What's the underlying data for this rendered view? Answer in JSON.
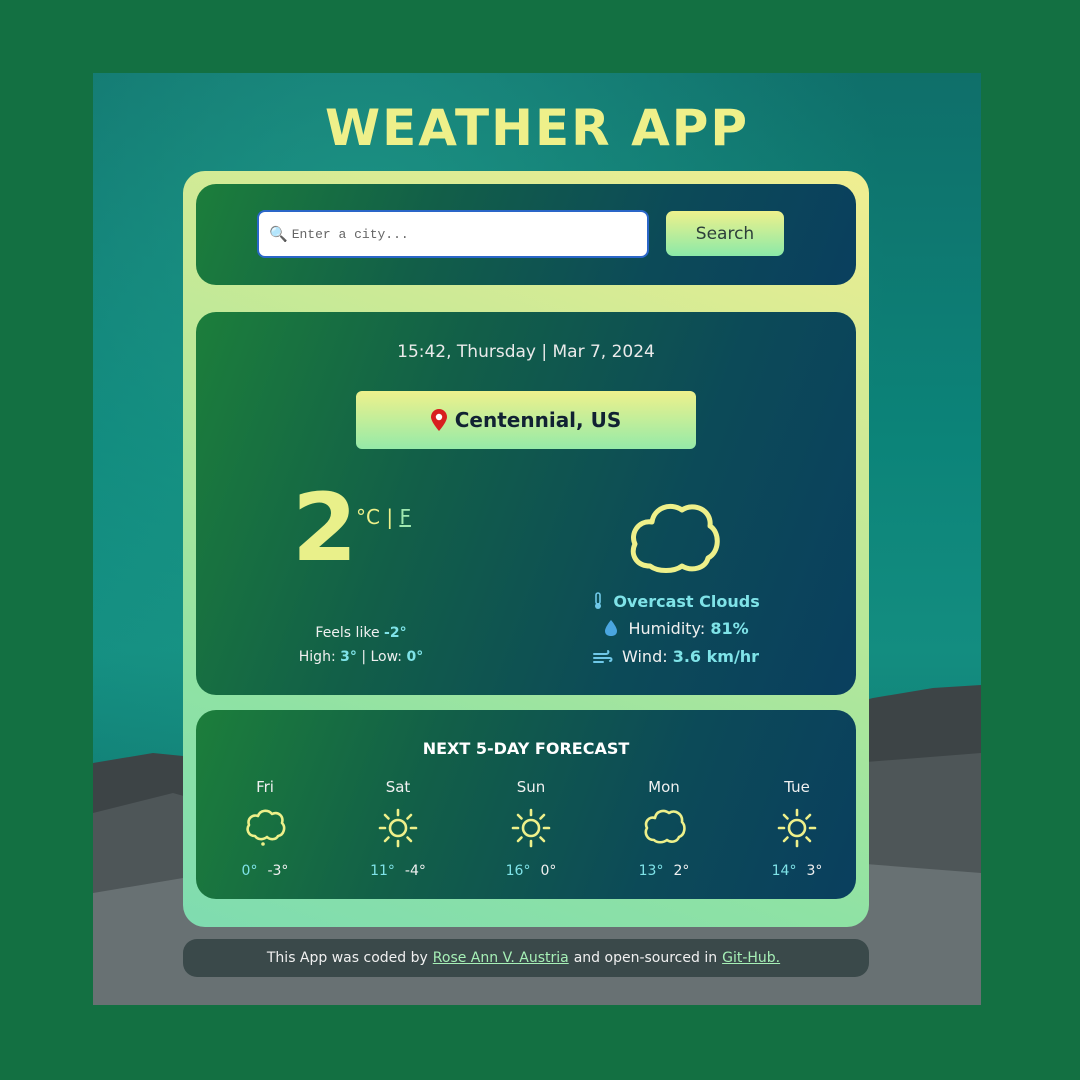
{
  "app": {
    "title": "WEATHER APP"
  },
  "search": {
    "placeholder": "Enter a city...",
    "button_label": "Search"
  },
  "current": {
    "datetime": "15:42, Thursday | Mar 7, 2024",
    "location": "Centennial, US",
    "temperature": "2",
    "unit_c": "°C",
    "unit_sep": "|",
    "unit_f": "F",
    "feels_like_label": "Feels like",
    "feels_like_value": "-2°",
    "high_label": "High:",
    "high_value": "3°",
    "low_sep": "|",
    "low_label": "Low:",
    "low_value": "0°",
    "description": "Overcast Clouds",
    "humidity_label": "Humidity:",
    "humidity_value": "81%",
    "wind_label": "Wind:",
    "wind_value": "3.6 km/hr",
    "icon": "cloud-icon"
  },
  "forecast": {
    "title": "NEXT 5-DAY FORECAST",
    "days": [
      {
        "day": "Fri",
        "icon": "rain-cloud-icon",
        "high": "0°",
        "low": "-3°"
      },
      {
        "day": "Sat",
        "icon": "sun-icon",
        "high": "11°",
        "low": "-4°"
      },
      {
        "day": "Sun",
        "icon": "sun-icon",
        "high": "16°",
        "low": "0°"
      },
      {
        "day": "Mon",
        "icon": "cloud-icon",
        "high": "13°",
        "low": "2°"
      },
      {
        "day": "Tue",
        "icon": "sun-icon",
        "high": "14°",
        "low": "3°"
      }
    ]
  },
  "footer": {
    "prefix": "This App was coded by",
    "author": "Rose Ann V. Austria",
    "middle": "and open-sourced in",
    "repo": "Git-Hub."
  },
  "colors": {
    "background": "#137042",
    "accent_yellow": "#eef08a",
    "accent_cyan": "#7fe3e8"
  }
}
